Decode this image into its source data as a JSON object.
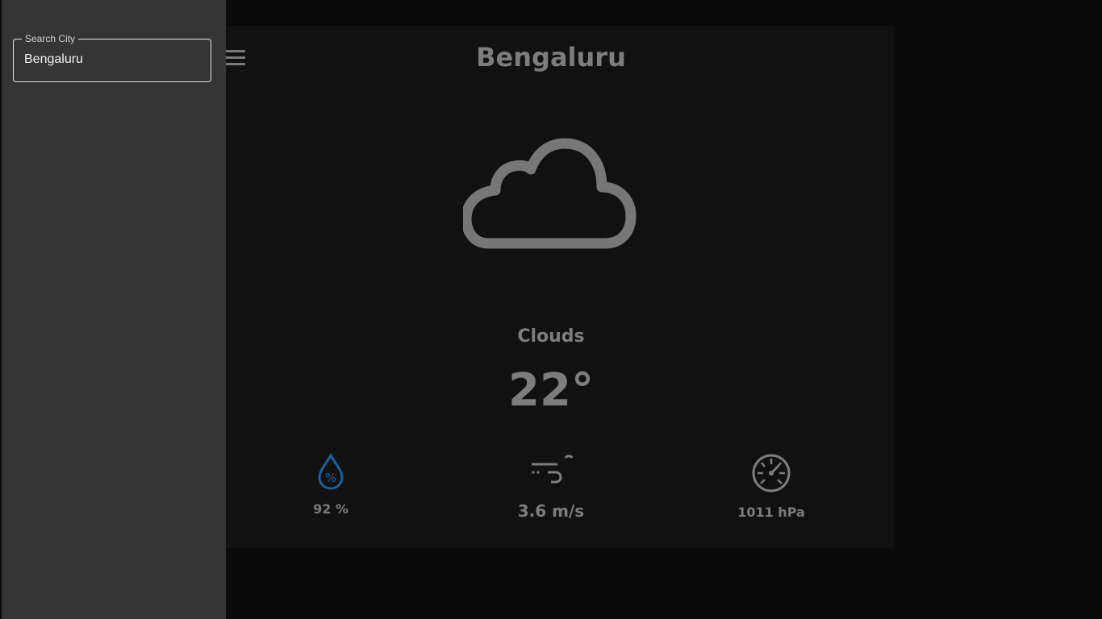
{
  "weather": {
    "city": "Bengaluru",
    "condition": "Clouds",
    "temperature": "22°",
    "condition_icon": "cloud-icon",
    "stats": {
      "humidity": {
        "value": "92 %",
        "icon": "humidity-drop-icon",
        "color": "#1e5f9e"
      },
      "wind": {
        "value": "3.6 m/s",
        "icon": "wind-icon"
      },
      "pressure": {
        "value": "1011 hPa",
        "icon": "pressure-gauge-icon"
      }
    }
  },
  "header": {
    "menu_icon": "hamburger-menu-icon"
  },
  "drawer": {
    "search": {
      "label": "Search City",
      "value": "Bengaluru"
    }
  },
  "colors": {
    "background": "#0a0a0a",
    "card": "#111111",
    "drawer": "#353535",
    "muted_text": "#7d7d7d"
  }
}
